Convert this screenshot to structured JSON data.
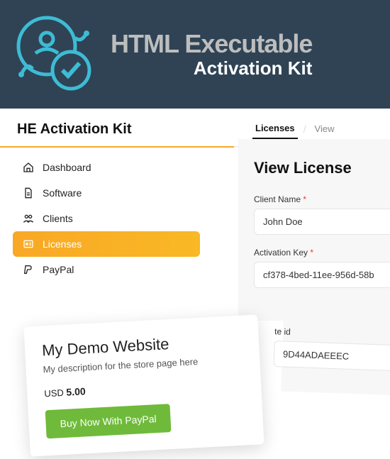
{
  "header": {
    "title": "HTML Executable",
    "subtitle": "Activation Kit"
  },
  "appTitle": "HE Activation Kit",
  "sidebar": {
    "items": [
      {
        "label": "Dashboard",
        "icon": "home"
      },
      {
        "label": "Software",
        "icon": "file"
      },
      {
        "label": "Clients",
        "icon": "users"
      },
      {
        "label": "Licenses",
        "icon": "license",
        "active": true
      },
      {
        "label": "PayPal",
        "icon": "paypal"
      }
    ]
  },
  "tabs": {
    "items": [
      "Licenses",
      "View"
    ],
    "active": "Licenses"
  },
  "panel": {
    "title": "View License",
    "fields": {
      "clientName": {
        "label": "Client Name",
        "value": "John Doe",
        "required": true
      },
      "activationKey": {
        "label": "Activation Key",
        "value": "cf378-4bed-11ee-956d-58b",
        "required": true
      },
      "siteId": {
        "label": "te id",
        "value": "9D44ADAEEEC",
        "required": false
      }
    }
  },
  "card": {
    "title": "My Demo Website",
    "description": "My description for the store page here",
    "currency": "USD",
    "price": "5.00",
    "buyLabel": "Buy Now With PayPal"
  }
}
